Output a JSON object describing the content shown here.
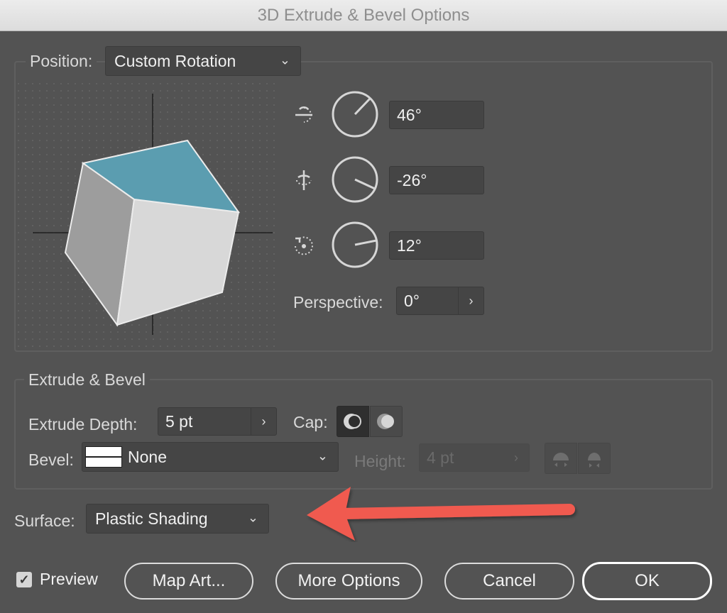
{
  "window": {
    "title": "3D Extrude & Bevel Options"
  },
  "position": {
    "label": "Position:",
    "value": "Custom Rotation",
    "x_rotation": "46°",
    "y_rotation": "-26°",
    "z_rotation": "12°",
    "perspective_label": "Perspective:",
    "perspective_value": "0°"
  },
  "extrude_bevel": {
    "title": "Extrude & Bevel",
    "extrude_depth_label": "Extrude Depth:",
    "extrude_depth_value": "5 pt",
    "cap_label": "Cap:",
    "bevel_label": "Bevel:",
    "bevel_value": "None",
    "height_label": "Height:",
    "height_value": "4 pt"
  },
  "surface": {
    "label": "Surface:",
    "value": "Plastic Shading"
  },
  "footer": {
    "preview_label": "Preview",
    "preview_checked": true,
    "map_art_label": "Map Art...",
    "more_options_label": "More Options",
    "cancel_label": "Cancel",
    "ok_label": "OK"
  },
  "colors": {
    "background": "#535353",
    "cube_top": "#5b9db0",
    "annotation_arrow": "#f05a50"
  },
  "icons": [
    "x-axis-rotate-icon",
    "y-axis-rotate-icon",
    "z-axis-rotate-icon",
    "chevron-down-icon",
    "chevron-right-icon",
    "cap-on-icon",
    "cap-off-icon",
    "bevel-in-icon",
    "bevel-out-icon",
    "checkmark-icon"
  ]
}
